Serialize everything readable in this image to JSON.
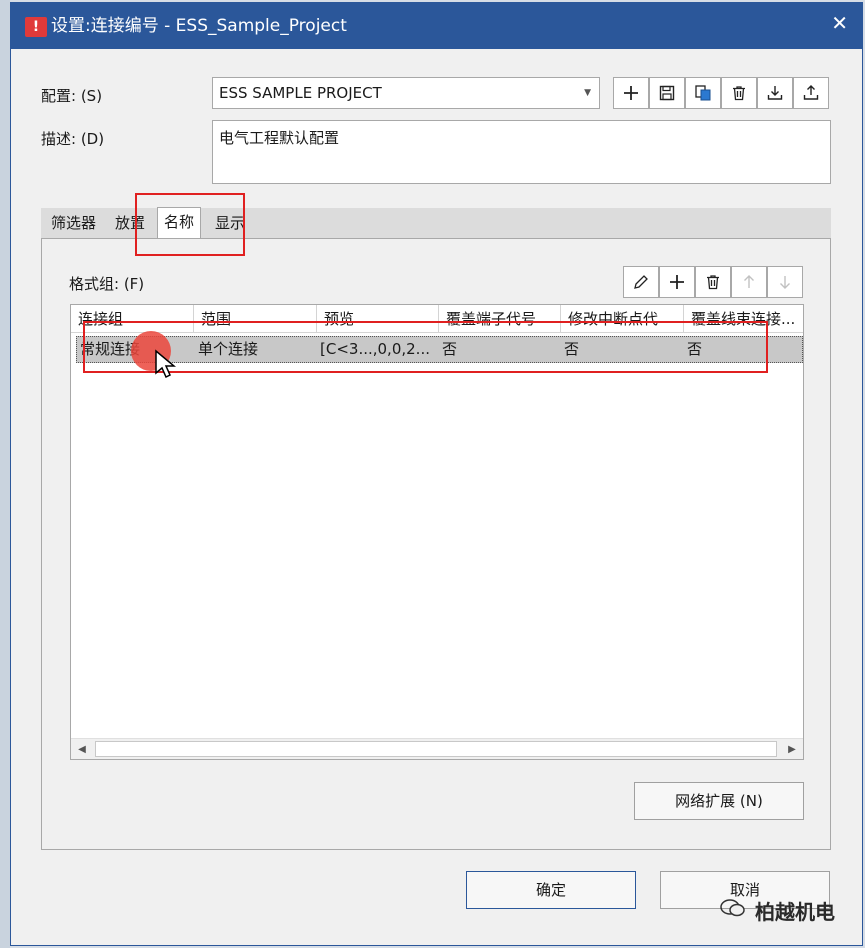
{
  "window": {
    "title": "设置:连接编号 - ESS_Sample_Project",
    "close_glyph": "✕"
  },
  "config": {
    "label": "配置: (S)",
    "value": "ESS SAMPLE PROJECT",
    "buttons": [
      "add-icon",
      "save-icon",
      "copy-icon",
      "delete-icon",
      "import-icon",
      "export-icon"
    ]
  },
  "description": {
    "label": "描述: (D)",
    "value": "电气工程默认配置"
  },
  "tabs": [
    {
      "label": "筛选器"
    },
    {
      "label": "放置"
    },
    {
      "label": "名称"
    },
    {
      "label": "显示"
    }
  ],
  "active_tab": "名称",
  "format_group": {
    "label": "格式组: (F)",
    "toolbar": [
      "edit-icon",
      "add-icon",
      "delete-icon",
      "move-up-icon",
      "move-down-icon"
    ]
  },
  "table": {
    "columns": [
      "连接组",
      "范围",
      "预览",
      "覆盖端子代号",
      "修改中断点代",
      "覆盖线束连接..."
    ],
    "rows": [
      [
        "常规连接",
        "单个连接",
        "[C<3...,0,0,2...",
        "否",
        "否",
        "否"
      ]
    ]
  },
  "network_button": "网络扩展 (N)",
  "ok_button": "确定",
  "cancel_button": "取消",
  "watermark": "柏越机电",
  "colors": {
    "titlebar": "#2b579a",
    "highlight": "#e02020",
    "selected_row": "#c8c8c8"
  }
}
